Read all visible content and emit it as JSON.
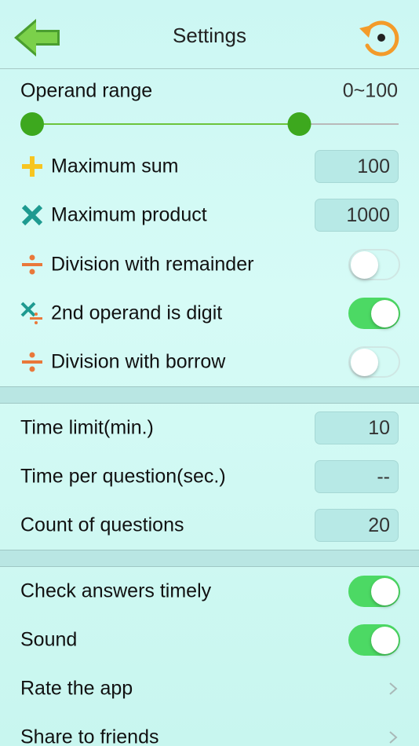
{
  "header": {
    "title": "Settings",
    "back_icon": "back-arrow-icon",
    "reset_icon": "reset-icon"
  },
  "colors": {
    "accent_green": "#4cd964",
    "slider_green": "#6cc43c",
    "plus_yellow": "#f7c520",
    "times_teal": "#1e9a90",
    "divide_orange": "#e9783a",
    "reset_orange": "#f39b2a"
  },
  "operand_range": {
    "label": "Operand range",
    "value_text": "0~100",
    "slider": {
      "min": 0,
      "max": 100,
      "low": 0,
      "high": 0.75
    }
  },
  "arith": [
    {
      "icon": "plus-icon",
      "label": "Maximum sum",
      "value": "100"
    },
    {
      "icon": "times-icon",
      "label": "Maximum product",
      "value": "1000"
    }
  ],
  "toggles_top": [
    {
      "icon": "divide-icon",
      "label": "Division with remainder",
      "on": false
    },
    {
      "icon": "times-divide-icon",
      "label": "2nd operand is digit",
      "on": true
    },
    {
      "icon": "divide-icon",
      "label": "Division with borrow",
      "on": false
    }
  ],
  "timing": [
    {
      "label": "Time limit(min.)",
      "value": "10"
    },
    {
      "label": "Time per question(sec.)",
      "value": "--"
    },
    {
      "label": "Count of questions",
      "value": "20"
    }
  ],
  "general": [
    {
      "label": "Check answers timely",
      "type": "toggle",
      "on": true
    },
    {
      "label": "Sound",
      "type": "toggle",
      "on": true
    },
    {
      "label": "Rate the app",
      "type": "link"
    },
    {
      "label": "Share to friends",
      "type": "link"
    }
  ]
}
